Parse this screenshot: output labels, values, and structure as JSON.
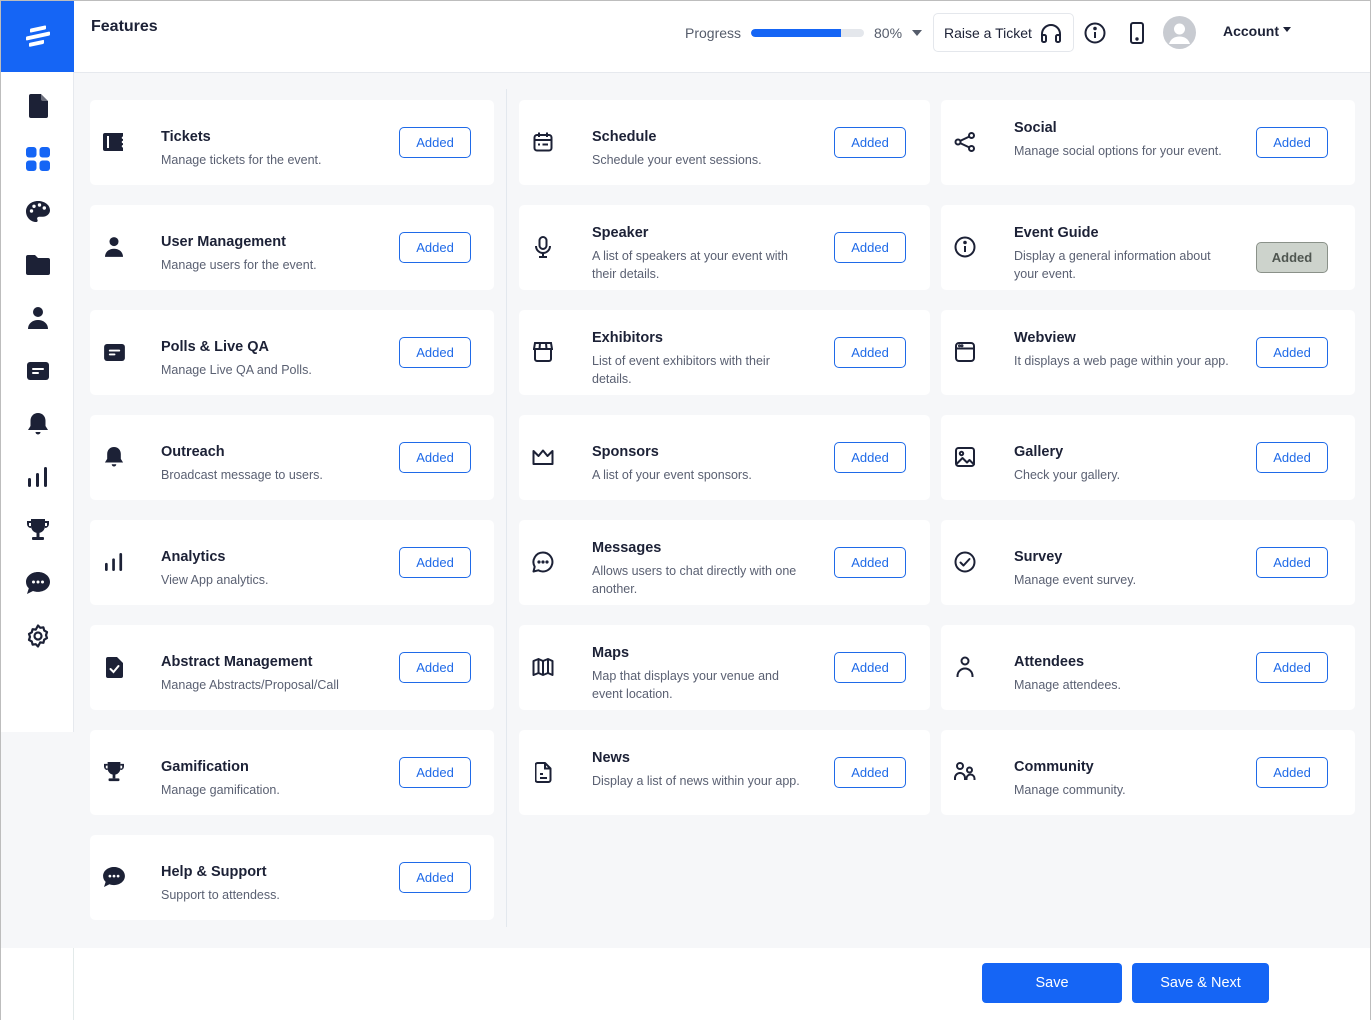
{
  "app": {
    "logo_icon": "brand-logo-icon",
    "accent_color": "#1565f5"
  },
  "sidebar": {
    "items": [
      {
        "id": "document",
        "icon": "document-icon",
        "active": false
      },
      {
        "id": "features",
        "icon": "grid-icon",
        "active": true
      },
      {
        "id": "design",
        "icon": "palette-icon",
        "active": false
      },
      {
        "id": "files",
        "icon": "folder-icon",
        "active": false
      },
      {
        "id": "users",
        "icon": "user-icon",
        "active": false
      },
      {
        "id": "polls",
        "icon": "message-box-icon",
        "active": false
      },
      {
        "id": "notifications",
        "icon": "bell-icon",
        "active": false
      },
      {
        "id": "analytics",
        "icon": "bar-chart-icon",
        "active": false
      },
      {
        "id": "gamification",
        "icon": "trophy-icon",
        "active": false
      },
      {
        "id": "chat",
        "icon": "chat-bubble-icon",
        "active": false
      },
      {
        "id": "settings",
        "icon": "gear-icon",
        "active": false
      }
    ]
  },
  "header": {
    "title": "Features",
    "progress_label": "Progress",
    "progress_value": 80,
    "progress_text": "80%",
    "raise_ticket_label": "Raise a Ticket",
    "account_label": "Account"
  },
  "features": {
    "columns": [
      [
        {
          "title": "Tickets",
          "description": "Manage tickets for the event.",
          "icon": "ticket-icon",
          "button": "Added",
          "disabled": false
        },
        {
          "title": "User Management",
          "description": "Manage users for the event.",
          "icon": "user-icon",
          "button": "Added",
          "disabled": false
        },
        {
          "title": "Polls & Live QA",
          "description": "Manage Live QA and Polls.",
          "icon": "message-box-icon",
          "button": "Added",
          "disabled": false
        },
        {
          "title": "Outreach",
          "description": "Broadcast message to users.",
          "icon": "bell-icon",
          "button": "Added",
          "disabled": false
        },
        {
          "title": "Analytics",
          "description": "View App analytics.",
          "icon": "bar-chart-icon",
          "button": "Added",
          "disabled": false
        },
        {
          "title": "Abstract Management",
          "description": "Manage Abstracts/Proposal/Call",
          "icon": "file-check-icon",
          "button": "Added",
          "disabled": false
        },
        {
          "title": "Gamification",
          "description": "Manage gamification.",
          "icon": "trophy-icon",
          "button": "Added",
          "disabled": false
        },
        {
          "title": "Help & Support",
          "description": "Support to attendess.",
          "icon": "chat-bubble-icon",
          "button": "Added",
          "disabled": false
        }
      ],
      [
        {
          "title": "Schedule",
          "description": "Schedule your event sessions.",
          "icon": "calendar-icon",
          "button": "Added",
          "disabled": false
        },
        {
          "title": "Speaker",
          "description": "A list of speakers at your event with their details.",
          "icon": "microphone-icon",
          "button": "Added",
          "disabled": false
        },
        {
          "title": "Exhibitors",
          "description": "List of event exhibitors with their details.",
          "icon": "store-icon",
          "button": "Added",
          "disabled": false
        },
        {
          "title": "Sponsors",
          "description": "A list of your event sponsors.",
          "icon": "crown-icon",
          "button": "Added",
          "disabled": false
        },
        {
          "title": "Messages",
          "description": "Allows users to chat directly with one another.",
          "icon": "chat-outline-icon",
          "button": "Added",
          "disabled": false
        },
        {
          "title": "Maps",
          "description": "Map that displays your venue and event location.",
          "icon": "map-icon",
          "button": "Added",
          "disabled": false
        },
        {
          "title": "News",
          "description": "Display a list of news within your app.",
          "icon": "news-document-icon",
          "button": "Added",
          "disabled": false
        }
      ],
      [
        {
          "title": "Social",
          "description": "Manage social options for your event.",
          "icon": "share-icon",
          "button": "Added",
          "disabled": false
        },
        {
          "title": "Event Guide",
          "description": "Display a general information about your event.",
          "icon": "info-icon",
          "button": "Added",
          "disabled": true
        },
        {
          "title": "Webview",
          "description": "It displays a web page within your app.",
          "icon": "browser-window-icon",
          "button": "Added",
          "disabled": false
        },
        {
          "title": "Gallery",
          "description": "Check your gallery.",
          "icon": "image-icon",
          "button": "Added",
          "disabled": false
        },
        {
          "title": "Survey",
          "description": "Manage event survey.",
          "icon": "check-circle-icon",
          "button": "Added",
          "disabled": false
        },
        {
          "title": "Attendees",
          "description": "Manage attendees.",
          "icon": "person-outline-icon",
          "button": "Added",
          "disabled": false
        },
        {
          "title": "Community",
          "description": "Manage community.",
          "icon": "people-icon",
          "button": "Added",
          "disabled": false
        }
      ]
    ]
  },
  "footer": {
    "save_label": "Save",
    "save_next_label": "Save & Next"
  }
}
